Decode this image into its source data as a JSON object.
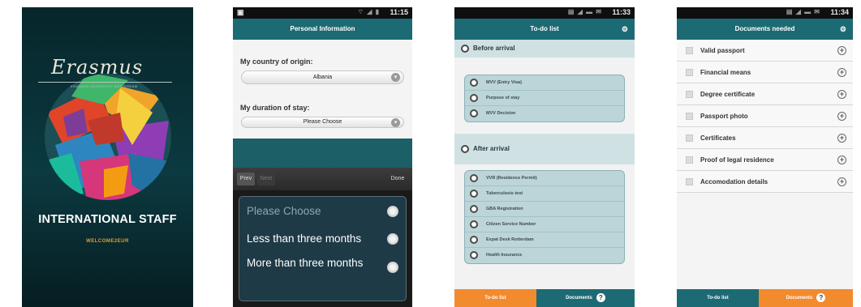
{
  "splash": {
    "logo": "Erasmus",
    "tagline": "ERASMUS UNIVERSITY ROTTERDAM",
    "title": "INTERNATIONAL STAFF",
    "subtitle": "WELCOME2EUR"
  },
  "personal": {
    "status_time": "11:15",
    "title": "Personal Information",
    "country_label": "My country of origin:",
    "country_value": "Albania",
    "duration_label": "My duration of stay:",
    "duration_value": "Please Choose",
    "prev": "Prev",
    "next": "Next",
    "done": "Done",
    "options": [
      "Please Choose",
      "Less than three months",
      "More than three months"
    ]
  },
  "todo": {
    "status_time": "11:33",
    "title": "To-do list",
    "before_label": "Before arrival",
    "before_items": [
      "MVV (Entry Visa)",
      "Purpose of stay",
      "MVV Decision"
    ],
    "after_label": "After arrival",
    "after_items": [
      "VVR (Residence Permit)",
      "Tuberculosis test",
      "GBA Registration",
      "Citizen Service Number",
      "Expat Desk Rotterdam",
      "Health Insurance"
    ],
    "tab_todo": "To-do list",
    "tab_docs": "Documents"
  },
  "documents": {
    "status_time": "11:34",
    "title": "Documents needed",
    "items": [
      "Valid passport",
      "Financial means",
      "Degree certificate",
      "Passport photo",
      "Certificates",
      "Proof of legal residence",
      "Accomodation details"
    ],
    "tab_todo": "To-do list",
    "tab_docs": "Documents"
  },
  "colors": {
    "teal": "#1c6a74",
    "accent_orange": "#f28a2e",
    "splash_bg": "#0b3a40"
  }
}
